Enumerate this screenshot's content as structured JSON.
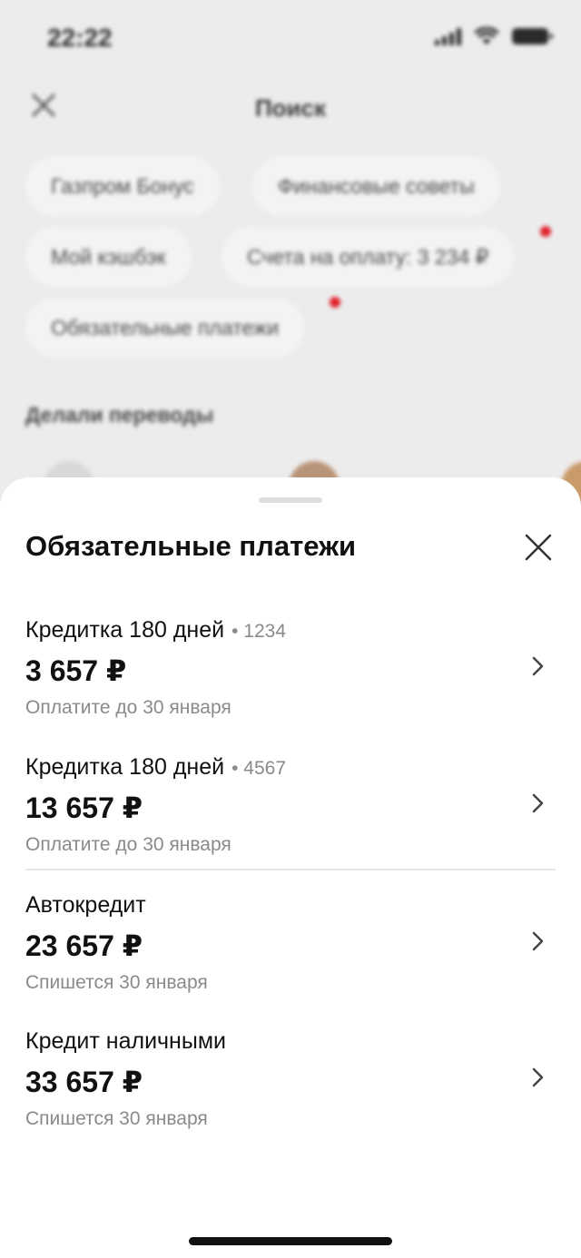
{
  "status_bar": {
    "time": "22:22"
  },
  "background_screen": {
    "title": "Поиск",
    "chips": [
      {
        "label": "Газпром Бонус",
        "has_dot": false
      },
      {
        "label": "Финансовые советы",
        "has_dot": false
      },
      {
        "label": "Мой кэшбэк",
        "has_dot": false
      },
      {
        "label": "Счета на оплату: 3 234 ₽",
        "has_dot": true
      },
      {
        "label": "Обязательные платежи",
        "has_dot": true
      }
    ],
    "section_title": "Делали переводы"
  },
  "sheet": {
    "title": "Обязательные платежи",
    "items": [
      {
        "name": "Кредитка 180 дней",
        "mask": "• 1234",
        "amount": "3 657 ₽",
        "note": "Оплатите до 30 января"
      },
      {
        "name": "Кредитка 180 дней",
        "mask": "• 4567",
        "amount": "13 657 ₽",
        "note": "Оплатите до 30 января"
      },
      {
        "name": "Автокредит",
        "mask": "",
        "amount": "23 657 ₽",
        "note": "Спишется 30 января"
      },
      {
        "name": "Кредит наличными",
        "mask": "",
        "amount": "33 657 ₽",
        "note": "Спишется 30 января"
      }
    ]
  },
  "colors": {
    "accent_dot": "#e0202a",
    "text_primary": "#111111",
    "text_secondary": "#8a8a8a"
  }
}
